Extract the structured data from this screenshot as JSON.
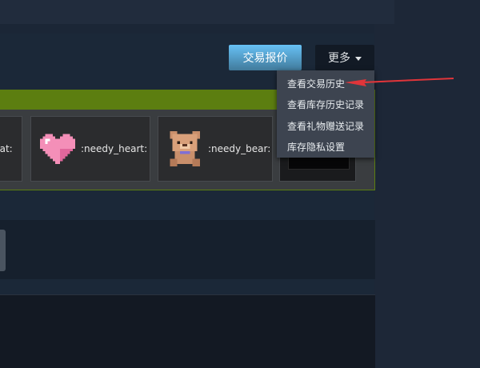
{
  "toolbar": {
    "offer_label": "交易报价",
    "more_label": "更多"
  },
  "emoticons": [
    {
      "label": "cat:",
      "icon": "cat-emoticon"
    },
    {
      "label": ":needy_heart:",
      "icon": "heart-emoticon"
    },
    {
      "label": ":needy_bear:",
      "icon": "bear-emoticon"
    }
  ],
  "dropdown": {
    "items": [
      {
        "label": "查看交易历史"
      },
      {
        "label": "查看库存历史记录"
      },
      {
        "label": "查看礼物赠送记录"
      },
      {
        "label": "库存隐私设置"
      }
    ]
  },
  "colors": {
    "accent_button": "#67c1f5",
    "panel_bar": "#5c7e10",
    "annotation_arrow": "#e0353a"
  }
}
